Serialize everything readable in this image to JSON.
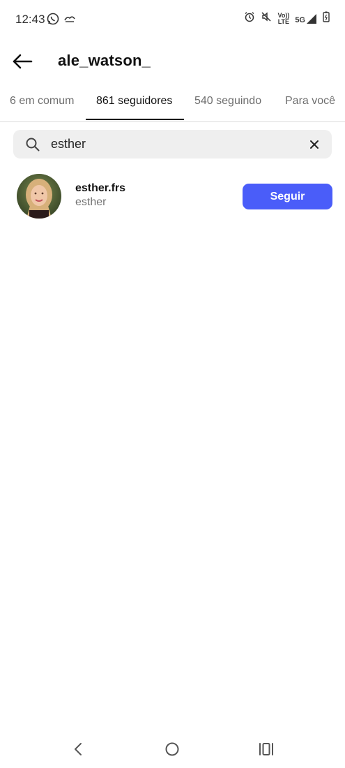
{
  "status_bar": {
    "time": "12:43",
    "left_icons": [
      "whatsapp-icon",
      "notification-icon"
    ],
    "right_icons": [
      "alarm-icon",
      "mute-icon",
      "volte-icon",
      "5g-signal-icon",
      "battery-icon"
    ],
    "volte_line1": "Vo))",
    "volte_line2": "LTE",
    "network": "5G"
  },
  "header": {
    "title": "ale_watson_",
    "back_icon": "back-arrow-icon"
  },
  "tabs": [
    {
      "label": "6 em comum",
      "active": false
    },
    {
      "label": "861 seguidores",
      "active": true
    },
    {
      "label": "540 seguindo",
      "active": false
    },
    {
      "label": "Para você",
      "active": false
    }
  ],
  "search": {
    "value": "esther",
    "icon": "search-icon",
    "clear_icon": "close-icon"
  },
  "results": [
    {
      "username": "esther.frs",
      "full_name": "esther",
      "button_label": "Seguir"
    }
  ],
  "colors": {
    "accent": "#4a5df9",
    "text_primary": "#111111",
    "text_secondary": "#737373",
    "search_bg": "#efefef"
  },
  "nav": [
    "back-nav-icon",
    "home-nav-icon",
    "recents-nav-icon"
  ]
}
